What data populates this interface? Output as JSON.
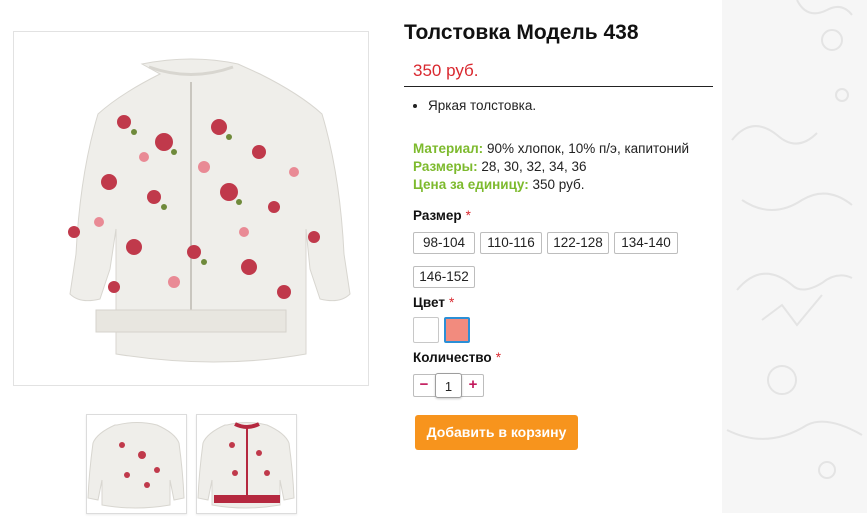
{
  "product": {
    "title": "Толстовка Модель 438",
    "price": "350 руб.",
    "bullets": [
      "Яркая толстовка."
    ],
    "specs": [
      {
        "label": "Материал:",
        "value": "90% хлопок, 10% п/э, капитоний"
      },
      {
        "label": "Размеры:",
        "value": "28, 30, 32, 34, 36"
      },
      {
        "label": "Цена за единицу:",
        "value": "350 руб."
      }
    ]
  },
  "options": {
    "size_label": "Размер",
    "required_mark": "*",
    "sizes": [
      "98-104",
      "110-116",
      "122-128",
      "134-140",
      "146-152"
    ],
    "color_label": "Цвет",
    "colors": [
      {
        "name": "white",
        "hex": "#ffffff"
      },
      {
        "name": "salmon",
        "hex": "#f28b7e",
        "selected": true
      }
    ],
    "quantity_label": "Количество",
    "quantity_value": "1",
    "minus": "−",
    "plus": "+"
  },
  "cart": {
    "button_label": "Добавить в корзину"
  },
  "colors": {
    "price": "#d9282f",
    "spec_label": "#7dba2d",
    "button": "#f7941d",
    "selected_border": "#2b8fd6"
  }
}
